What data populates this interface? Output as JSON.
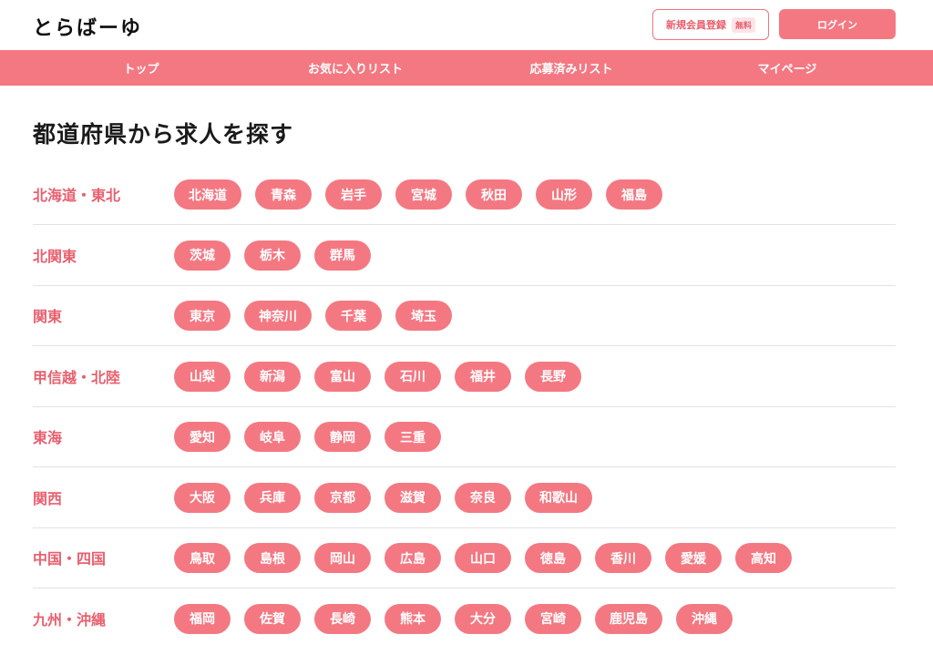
{
  "header": {
    "logo": "とらばーゆ",
    "register_label": "新規会員登録",
    "register_badge": "無料",
    "login_label": "ログイン"
  },
  "nav": {
    "items": [
      {
        "label": "トップ"
      },
      {
        "label": "お気に入りリスト"
      },
      {
        "label": "応募済みリスト"
      },
      {
        "label": "マイページ"
      }
    ]
  },
  "main": {
    "title": "都道府県から求人を探す",
    "regions": [
      {
        "name": "北海道・東北",
        "prefectures": [
          "北海道",
          "青森",
          "岩手",
          "宮城",
          "秋田",
          "山形",
          "福島"
        ]
      },
      {
        "name": "北関東",
        "prefectures": [
          "茨城",
          "栃木",
          "群馬"
        ]
      },
      {
        "name": "関東",
        "prefectures": [
          "東京",
          "神奈川",
          "千葉",
          "埼玉"
        ]
      },
      {
        "name": "甲信越・北陸",
        "prefectures": [
          "山梨",
          "新潟",
          "富山",
          "石川",
          "福井",
          "長野"
        ]
      },
      {
        "name": "東海",
        "prefectures": [
          "愛知",
          "岐阜",
          "静岡",
          "三重"
        ]
      },
      {
        "name": "関西",
        "prefectures": [
          "大阪",
          "兵庫",
          "京都",
          "滋賀",
          "奈良",
          "和歌山"
        ]
      },
      {
        "name": "中国・四国",
        "prefectures": [
          "鳥取",
          "島根",
          "岡山",
          "広島",
          "山口",
          "徳島",
          "香川",
          "愛媛",
          "高知"
        ]
      },
      {
        "name": "九州・沖縄",
        "prefectures": [
          "福岡",
          "佐賀",
          "長崎",
          "熊本",
          "大分",
          "宮崎",
          "鹿児島",
          "沖縄"
        ]
      }
    ]
  },
  "colors": {
    "accent": "#f47882",
    "accent_text": "#e8606e"
  }
}
